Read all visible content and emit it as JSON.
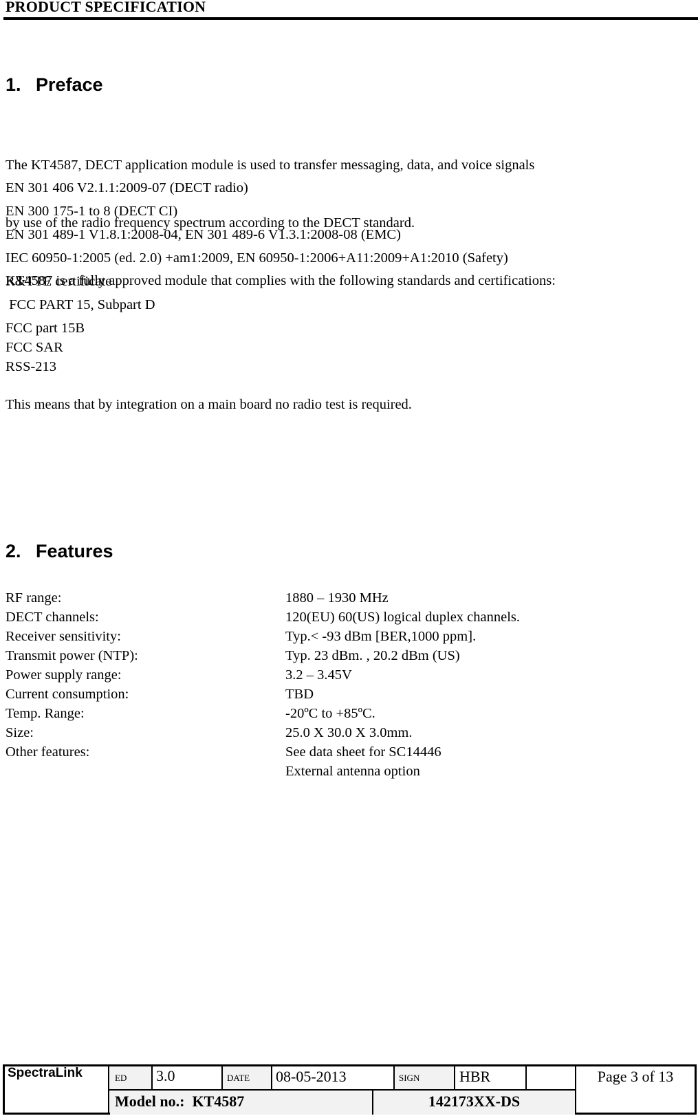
{
  "header": {
    "title": "PRODUCT SPECIFICATION"
  },
  "sections": {
    "preface": {
      "number": "1.",
      "title": "Preface",
      "intro_lines": [
        "The KT4587, DECT application module is used to transfer messaging, data, and voice signals",
        "by use of the radio frequency spectrum according to the DECT standard.",
        "KT4587 is a fully approved module that complies with the following standards and certifications:"
      ],
      "standards": [
        "EN 301 406 V2.1.1:2009-07 (DECT radio)",
        "EN 300 175-1 to 8 (DECT CI)",
        "EN 301 489-1 V1.8.1:2008-04, EN 301 489-6 V1.3.1:2008-08 (EMC)",
        "IEC 60950-1:2005 (ed. 2.0) +am1:2009, EN 60950-1:2006+A11:2009+A1:2010 (Safety)",
        "R&TTE certificate",
        " FCC PART 15, Subpart D",
        "FCC part 15B",
        "FCC SAR",
        "RSS-213"
      ],
      "conclusion": "This means that by integration on a main board no radio test is required."
    },
    "features": {
      "number": "2.",
      "title": "Features",
      "rows": [
        {
          "label": "RF range:",
          "value": "1880 – 1930 MHz"
        },
        {
          "label": "DECT channels:",
          "value": "120(EU) 60(US) logical duplex channels."
        },
        {
          "label": "Receiver sensitivity:",
          "value": "Typ.< -93 dBm [BER,1000 ppm]."
        },
        {
          "label": "Transmit power (NTP):",
          "value": "Typ. 23 dBm. , 20.2 dBm (US)"
        },
        {
          "label": "Power supply range:",
          "value": "3.2 – 3.45V"
        },
        {
          "label": "Current consumption:",
          "value": "TBD"
        },
        {
          "label": "Temp. Range:",
          "value": "-20ºC to +85ºC."
        },
        {
          "label": "Size:",
          "value": "25.0 X 30.0 X 3.0mm."
        },
        {
          "label": "Other features:",
          "value": "See data sheet for SC14446"
        },
        {
          "label": "",
          "value": "External antenna option"
        }
      ]
    }
  },
  "footer": {
    "company": "SpectraLink",
    "ed_label": "ED",
    "ed_value": "3.0",
    "date_label": "DATE",
    "date_value": "08-05-2013",
    "sign_label": "SIGN",
    "sign_value": "HBR",
    "page": "Page 3 of 13",
    "model": "Model no.:  KT4587",
    "doc_number": "142173XX-DS"
  }
}
